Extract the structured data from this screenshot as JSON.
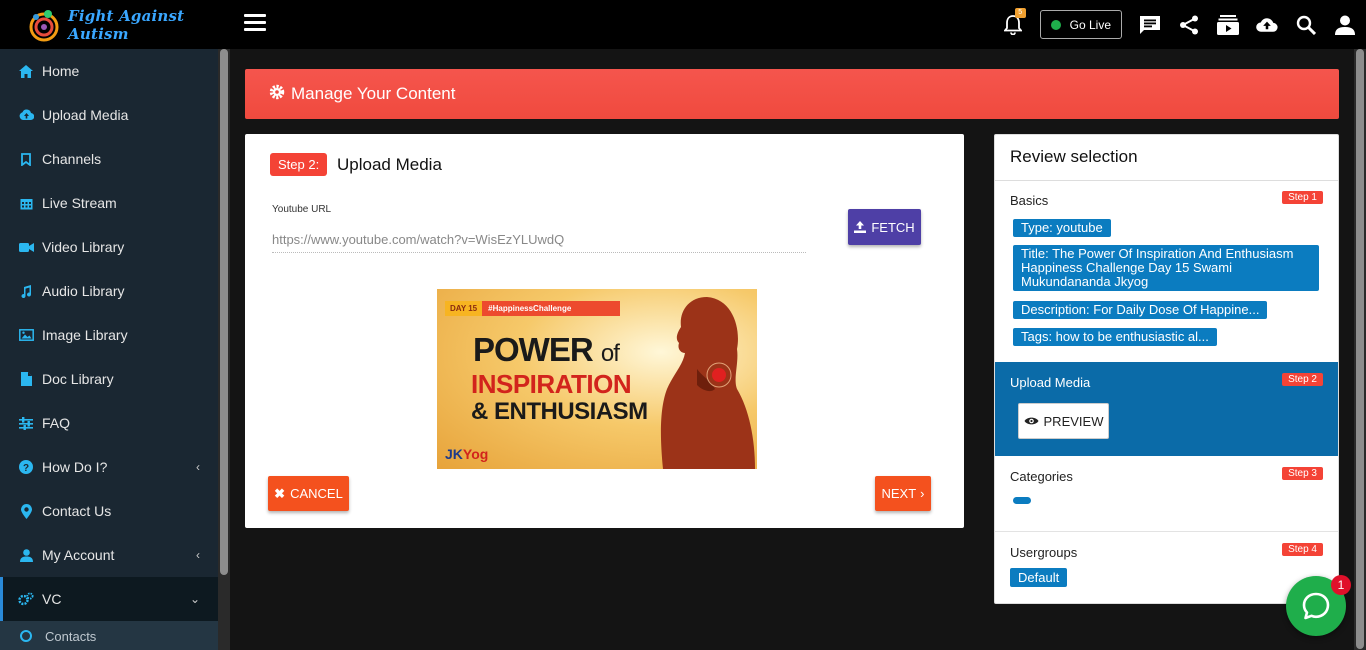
{
  "brand": {
    "name": "Fight Against Autism"
  },
  "sidebar": {
    "items": [
      {
        "label": "Home",
        "icon": "home-icon"
      },
      {
        "label": "Upload Media",
        "icon": "cloud-upload-icon"
      },
      {
        "label": "Channels",
        "icon": "bookmark-icon"
      },
      {
        "label": "Live Stream",
        "icon": "calendar-icon"
      },
      {
        "label": "Video Library",
        "icon": "video-camera-icon"
      },
      {
        "label": "Audio Library",
        "icon": "music-note-icon"
      },
      {
        "label": "Image Library",
        "icon": "image-icon"
      },
      {
        "label": "Doc Library",
        "icon": "document-icon"
      },
      {
        "label": "FAQ",
        "icon": "sliders-icon"
      },
      {
        "label": "How Do I?",
        "icon": "question-circle-icon"
      },
      {
        "label": "Contact Us",
        "icon": "map-marker-icon"
      },
      {
        "label": "My Account",
        "icon": "user-icon"
      },
      {
        "label": "VC",
        "icon": "cogs-icon"
      }
    ],
    "sub_items": [
      {
        "label": "Contacts",
        "icon": "circle-icon"
      }
    ]
  },
  "topbar": {
    "notification_count": "5",
    "go_live_label": "Go Live"
  },
  "banner": {
    "title": "Manage Your Content"
  },
  "upload_card": {
    "step_label": "Step 2:",
    "title": "Upload Media",
    "url_label": "Youtube URL",
    "url_value": "https://www.youtube.com/watch?v=WisEzYLUwdQ",
    "fetch_label": "FETCH",
    "thumbnail": {
      "day": "DAY 15",
      "hashtag": "#HappinessChallenge",
      "line1": "POWER",
      "line1_suffix": "of",
      "line2": "INSPIRATION",
      "line3": "& ENTHUSIASM",
      "brand_a": "JK",
      "brand_b": "Yog"
    },
    "cancel_label": "CANCEL",
    "next_label": "NEXT"
  },
  "review": {
    "title": "Review selection",
    "basics": {
      "label": "Basics",
      "step": "Step 1",
      "type": "Type: youtube",
      "title": "Title: The Power Of Inspiration And Enthusiasm Happiness Challenge Day 15 Swami Mukundananda Jkyog",
      "description": "Description: For Daily Dose Of Happine...",
      "tags": "Tags: how to be enthusiastic al..."
    },
    "upload": {
      "label": "Upload Media",
      "step": "Step 2",
      "preview_label": "PREVIEW"
    },
    "categories": {
      "label": "Categories",
      "step": "Step 3"
    },
    "usergroups": {
      "label": "Usergroups",
      "step": "Step 4",
      "value": "Default"
    }
  },
  "chat": {
    "badge": "1"
  },
  "colors": {
    "accent_red": "#f44336",
    "accent_blue": "#0b7cc0",
    "sidebar_bg": "#1a2732",
    "icon_cyan": "#2bb7f0",
    "fetch_purple": "#4e3fa6",
    "action_orange": "#f4511e",
    "chat_green": "#1fae4b"
  }
}
